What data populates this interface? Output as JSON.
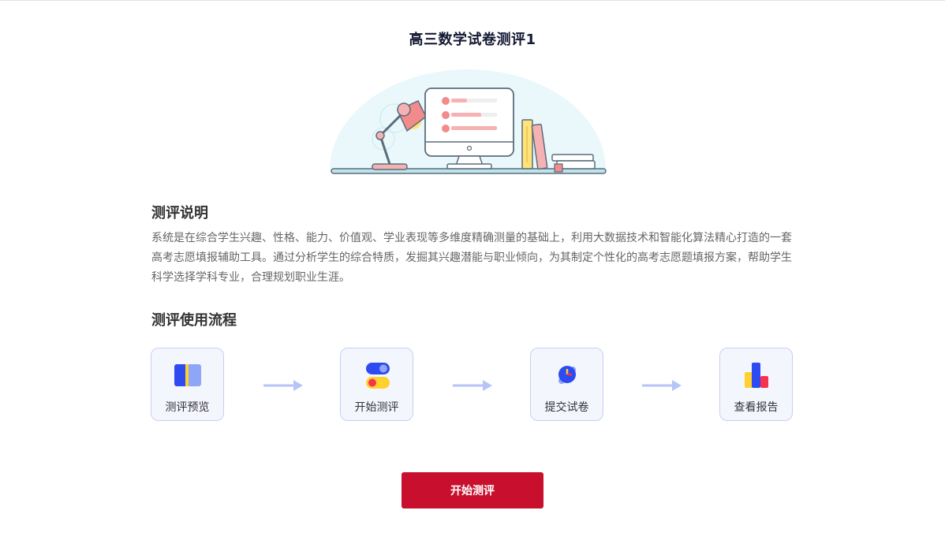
{
  "page": {
    "title": "高三数学试卷测评1"
  },
  "intro": {
    "heading": "测评说明",
    "text": "系统是在综合学生兴趣、性格、能力、价值观、学业表现等多维度精确测量的基础上，利用大数据技术和智能化算法精心打造的一套高考志愿填报辅助工具。通过分析学生的综合特质，发掘其兴趣潜能与职业倾向，为其制定个性化的高考志愿题填报方案，帮助学生科学选择学科专业，合理规划职业生涯。"
  },
  "process": {
    "heading": "测评使用流程",
    "steps": [
      {
        "label": "测评预览",
        "icon": "book-icon"
      },
      {
        "label": "开始测评",
        "icon": "toggle-icon"
      },
      {
        "label": "提交试卷",
        "icon": "clock-icon"
      },
      {
        "label": "查看报告",
        "icon": "bar-chart-icon"
      }
    ]
  },
  "actions": {
    "start_label": "开始测评"
  },
  "colors": {
    "accent": "#c8102e",
    "step_border": "#c7cff5",
    "step_bg": "#f4f6fe",
    "arrow": "#b7c4f7"
  }
}
